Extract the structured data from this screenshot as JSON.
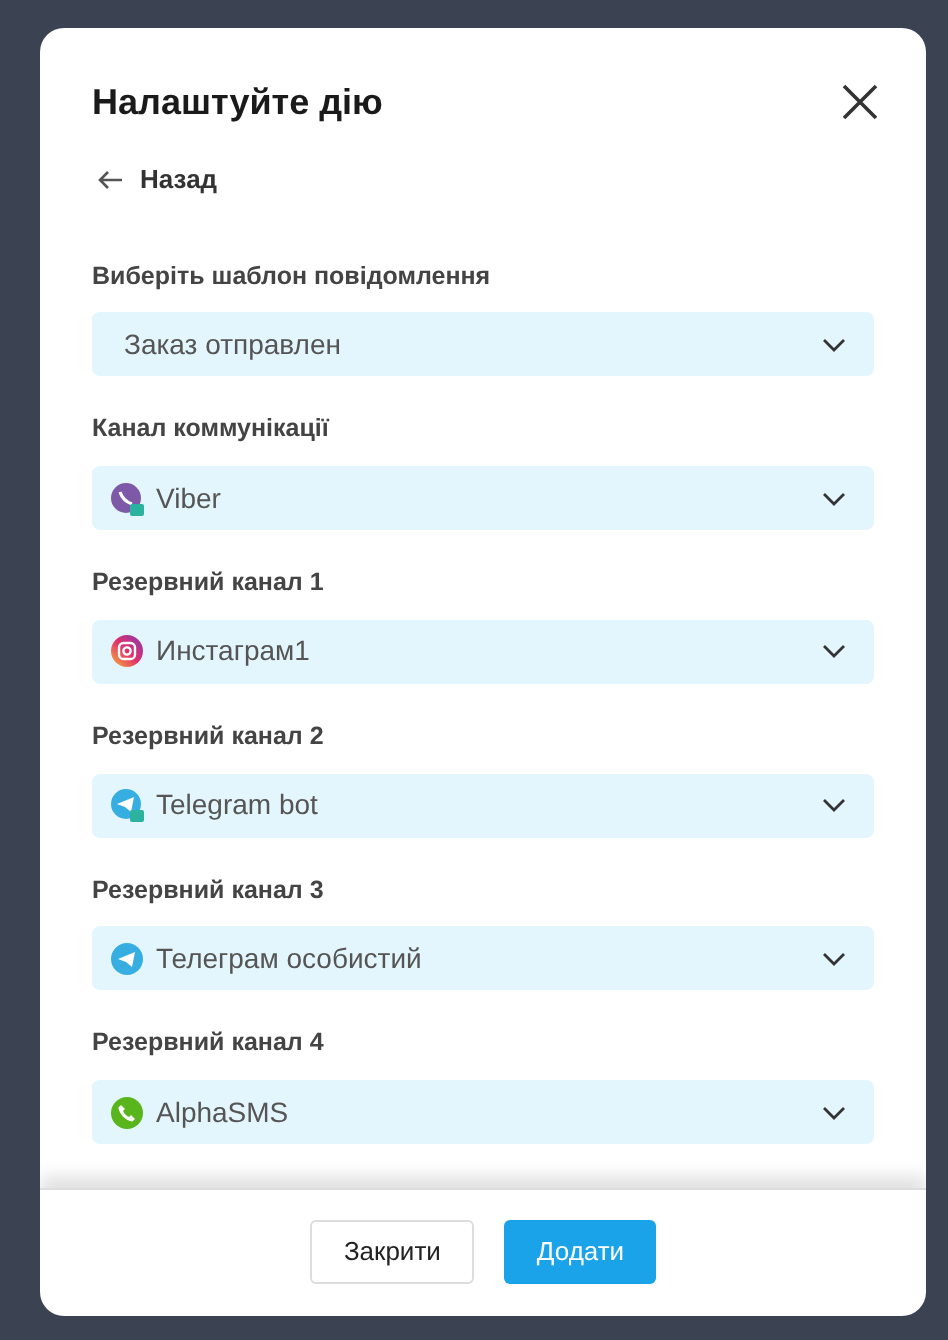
{
  "dialog": {
    "title": "Налаштуйте дію",
    "back": "Назад"
  },
  "fields": [
    {
      "label": "Виберіть шаблон повідомлення",
      "value": "Заказ отправлен",
      "kind": "plain"
    },
    {
      "label": "Канал коммунікації",
      "value": "Viber",
      "kind": "viber"
    },
    {
      "label": "Резервний канал 1",
      "value": "Инстаграм1",
      "kind": "instagram"
    },
    {
      "label": "Резервний канал 2",
      "value": "Telegram bot",
      "kind": "telegram-bot"
    },
    {
      "label": "Резервний канал 3",
      "value": "Телеграм особистий",
      "kind": "telegram"
    },
    {
      "label": "Резервний канал 4",
      "value": "AlphaSMS",
      "kind": "phone"
    }
  ],
  "buttons": [
    {
      "label": "Закрити",
      "kind": "secondary"
    },
    {
      "label": "Додати",
      "kind": "primary"
    }
  ]
}
